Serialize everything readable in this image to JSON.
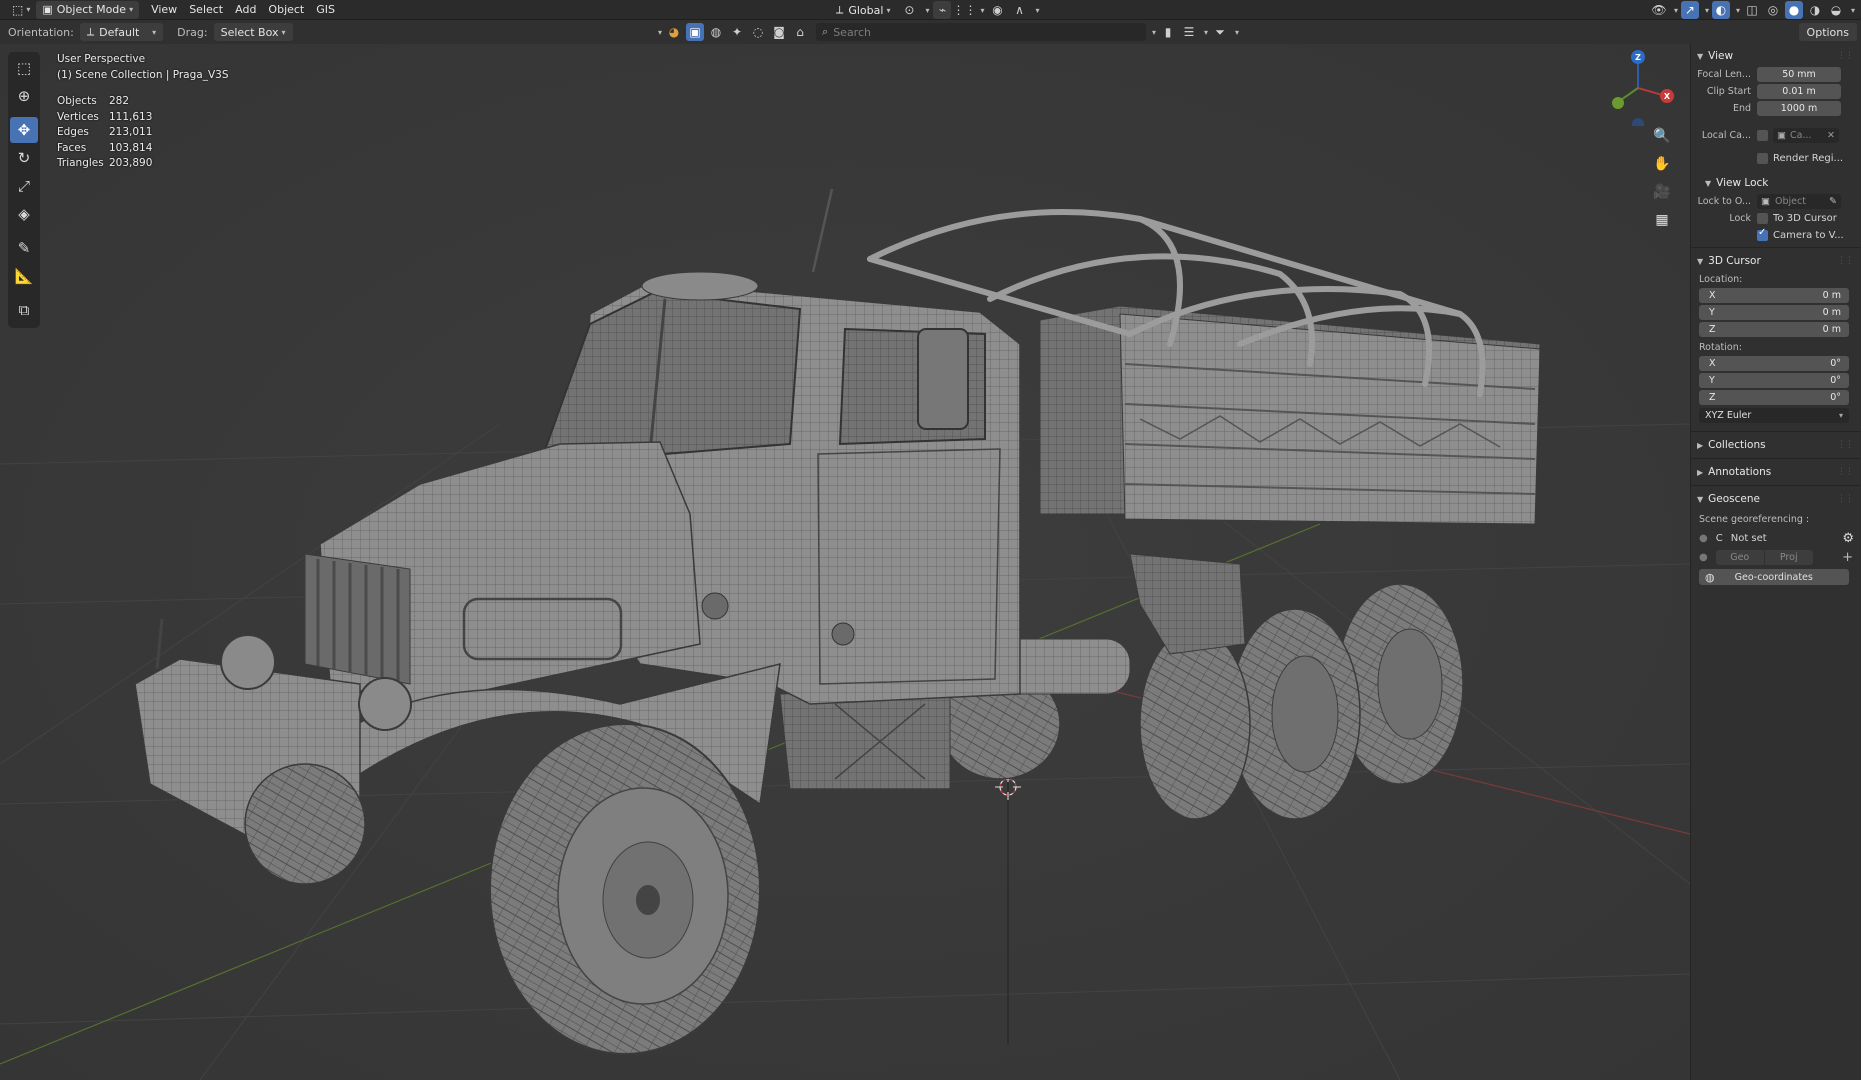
{
  "header": {
    "mode": "Object Mode",
    "menus": [
      "View",
      "Select",
      "Add",
      "Object",
      "GIS"
    ],
    "transform_orientation": "Global"
  },
  "toolheader": {
    "orientation_label": "Orientation:",
    "orientation_value": "Default",
    "drag_label": "Drag:",
    "drag_value": "Select Box",
    "search_placeholder": "Search",
    "options": "Options"
  },
  "viewport": {
    "perspective": "User Perspective",
    "collection": "(1) Scene Collection | Praga_V3S",
    "stats": [
      {
        "label": "Objects",
        "value": "282"
      },
      {
        "label": "Vertices",
        "value": "111,613"
      },
      {
        "label": "Edges",
        "value": "213,011"
      },
      {
        "label": "Faces",
        "value": "103,814"
      },
      {
        "label": "Triangles",
        "value": "203,890"
      }
    ],
    "gizmo": {
      "z": "Z",
      "x": "X"
    }
  },
  "sidebar": {
    "view": {
      "title": "View",
      "focal_label": "Focal Len...",
      "focal_value": "50 mm",
      "clip_start_label": "Clip Start",
      "clip_start_value": "0.01 m",
      "end_label": "End",
      "end_value": "1000 m",
      "local_camera_label": "Local Ca...",
      "local_camera_value": "Ca...",
      "render_region": "Render Regi..."
    },
    "view_lock": {
      "title": "View Lock",
      "lock_object_label": "Lock to O...",
      "lock_object_placeholder": "Object",
      "lock_label": "Lock",
      "to_cursor": "To 3D Cursor",
      "camera_to_view": "Camera to V..."
    },
    "cursor": {
      "title": "3D Cursor",
      "location_label": "Location:",
      "loc_x_label": "X",
      "loc_x": "0 m",
      "loc_y_label": "Y",
      "loc_y": "0 m",
      "loc_z_label": "Z",
      "loc_z": "0 m",
      "rotation_label": "Rotation:",
      "rot_x_label": "X",
      "rot_x": "0°",
      "rot_y_label": "Y",
      "rot_y": "0°",
      "rot_z_label": "Z",
      "rot_z": "0°",
      "rotation_mode": "XYZ Euler"
    },
    "collections": "Collections",
    "annotations": "Annotations",
    "geoscene": {
      "title": "Geoscene",
      "georef_label": "Scene georeferencing :",
      "crs_prefix": "C",
      "crs_value": "Not set",
      "geo_btn": "Geo",
      "proj_btn": "Proj",
      "geocoords_btn": "Geo-coordinates"
    }
  }
}
